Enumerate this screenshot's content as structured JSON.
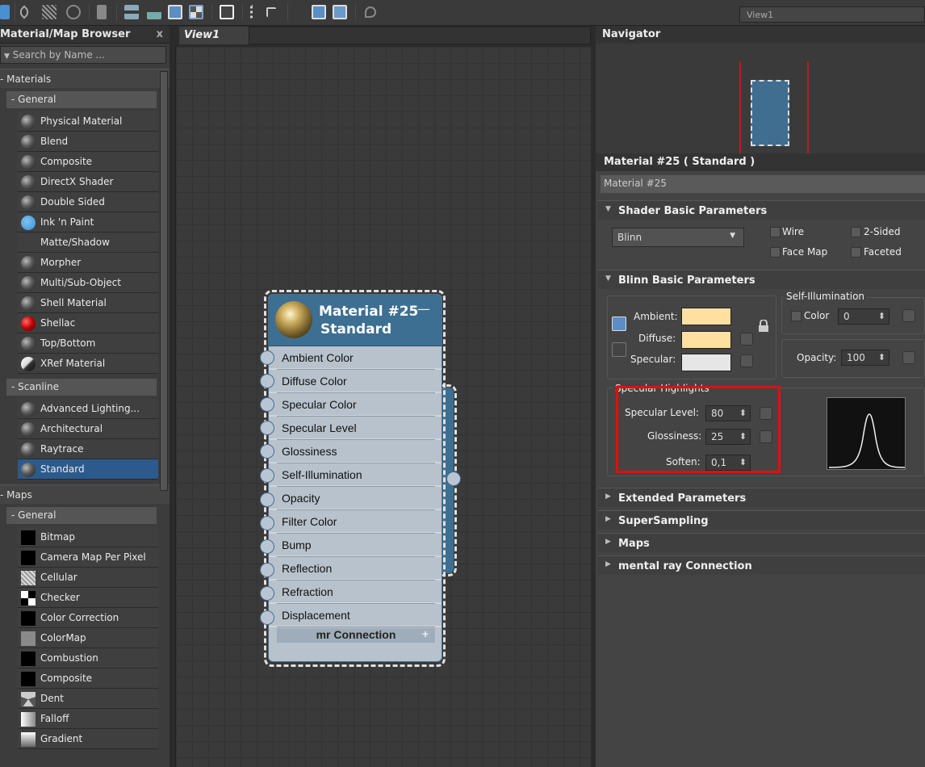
{
  "toolbar": {
    "view_select": "View1"
  },
  "browser": {
    "title": "Material/Map Browser",
    "close": "x",
    "search_placeholder": "Search by Name ...",
    "materials_header": "- Materials",
    "general_header": "- General",
    "general_items": [
      "Physical Material",
      "Blend",
      "Composite",
      "DirectX Shader",
      "Double Sided",
      "Ink 'n Paint",
      "Matte/Shadow",
      "Morpher",
      "Multi/Sub-Object",
      "Shell Material",
      "Shellac",
      "Top/Bottom",
      "XRef Material"
    ],
    "scanline_header": "- Scanline",
    "scanline_items": [
      "Advanced Lighting...",
      "Architectural",
      "Raytrace",
      "Standard"
    ],
    "maps_header": "- Maps",
    "maps_general_header": "- General",
    "maps_items": [
      "Bitmap",
      "Camera Map Per Pixel",
      "Cellular",
      "Checker",
      "Color Correction",
      "ColorMap",
      "Combustion",
      "Composite",
      "Dent",
      "Falloff",
      "Gradient"
    ]
  },
  "view": {
    "tab_label": "View1"
  },
  "node": {
    "name": "Material #25",
    "type": "Standard",
    "minimize": "—",
    "slots": [
      "Ambient Color",
      "Diffuse Color",
      "Specular Color",
      "Specular Level",
      "Glossiness",
      "Self-Illumination",
      "Opacity",
      "Filter Color",
      "Bump",
      "Reflection",
      "Refraction",
      "Displacement"
    ],
    "mr_connection": "mr Connection",
    "mr_plus": "+"
  },
  "navigator": {
    "title": "Navigator"
  },
  "material_panel": {
    "title": "Material #25  ( Standard )",
    "name_field": "Material #25",
    "shader_rollout": "Shader Basic Parameters",
    "shader_value": "Blinn",
    "wire": "Wire",
    "two_sided": "2-Sided",
    "face_map": "Face Map",
    "faceted": "Faceted",
    "blinn_rollout": "Blinn Basic Parameters",
    "self_illum_label": "Self-Illumination",
    "color_label": "Color",
    "color_value": "0",
    "ambient": "Ambient:",
    "diffuse": "Diffuse:",
    "specular": "Specular:",
    "opacity_label": "Opacity:",
    "opacity_value": "100",
    "spec_highlights": "Specular Highlights",
    "spec_level_label": "Specular Level:",
    "spec_level_value": "80",
    "glossiness_label": "Glossiness:",
    "glossiness_value": "25",
    "soften_label": "Soften:",
    "soften_value": "0,1",
    "extended": "Extended Parameters",
    "supersampling": "SuperSampling",
    "maps": "Maps",
    "mental_ray": "mental ray Connection"
  },
  "colors": {
    "ambient": "#ffe0a0",
    "diffuse": "#ffe0a0",
    "specular": "#e6e6e6",
    "selection": "#2c5a8c",
    "highlight_box": "#dd1010"
  }
}
